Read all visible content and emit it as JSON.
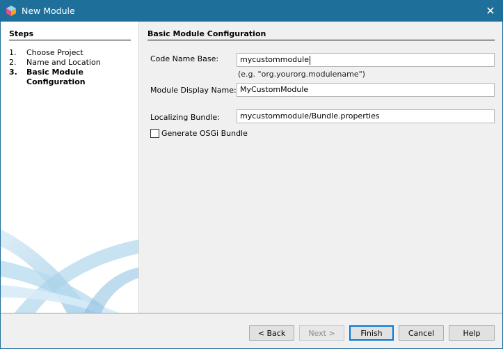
{
  "window": {
    "title": "New Module",
    "close_symbol": "✕"
  },
  "steps": {
    "title": "Steps",
    "items": [
      {
        "num": "1.",
        "label": "Choose Project"
      },
      {
        "num": "2.",
        "label": "Name and Location"
      },
      {
        "num": "3.",
        "label": "Basic Module Configuration"
      }
    ]
  },
  "main": {
    "title": "Basic Module Configuration",
    "code_name_base": {
      "label": "Code Name Base:",
      "value": "mycustommodule",
      "hint": "(e.g. \"org.yourorg.modulename\")"
    },
    "display_name": {
      "label": "Module Display Name:",
      "value": "MyCustomModule"
    },
    "localizing_bundle": {
      "label": "Localizing Bundle:",
      "value": "mycustommodule/Bundle.properties"
    },
    "osgi": {
      "label": "Generate OSGi Bundle",
      "checked": false
    }
  },
  "buttons": {
    "back": "< Back",
    "next": "Next >",
    "finish": "Finish",
    "cancel": "Cancel",
    "help": "Help"
  },
  "colors": {
    "titlebar": "#1f6f9b",
    "accent": "#0078d7"
  }
}
